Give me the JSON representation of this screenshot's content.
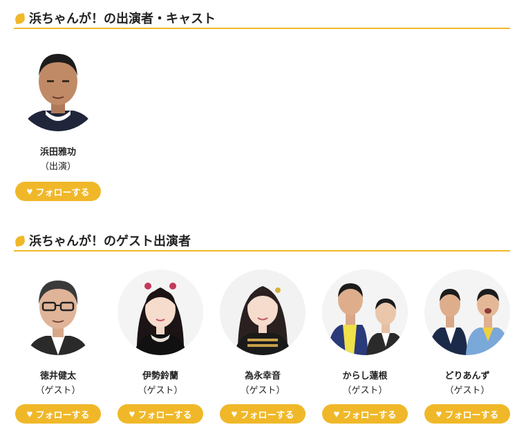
{
  "sections": [
    {
      "title": "浜ちゃんが！の出演者・キャスト",
      "people": [
        {
          "name": "浜田雅功",
          "role": "（出演）",
          "follow_label": "フォローする",
          "follow_icon": "heart-icon"
        }
      ]
    },
    {
      "title": "浜ちゃんが！のゲスト出演者",
      "people": [
        {
          "name": "徳井健太",
          "role": "（ゲスト）",
          "follow_label": "フォローする",
          "follow_icon": "heart-icon"
        },
        {
          "name": "伊勢鈴蘭",
          "role": "（ゲスト）",
          "follow_label": "フォローする",
          "follow_icon": "heart-icon"
        },
        {
          "name": "為永幸音",
          "role": "（ゲスト）",
          "follow_label": "フォローする",
          "follow_icon": "heart-icon"
        },
        {
          "name": "からし蓮根",
          "role": "（ゲスト）",
          "follow_label": "フォローする",
          "follow_icon": "heart-icon"
        },
        {
          "name": "どりあんず",
          "role": "（ゲスト）",
          "follow_label": "フォローする",
          "follow_icon": "heart-icon"
        }
      ]
    }
  ],
  "colors": {
    "accent": "#f0b829",
    "text": "#222222",
    "button_text": "#ffffff"
  }
}
